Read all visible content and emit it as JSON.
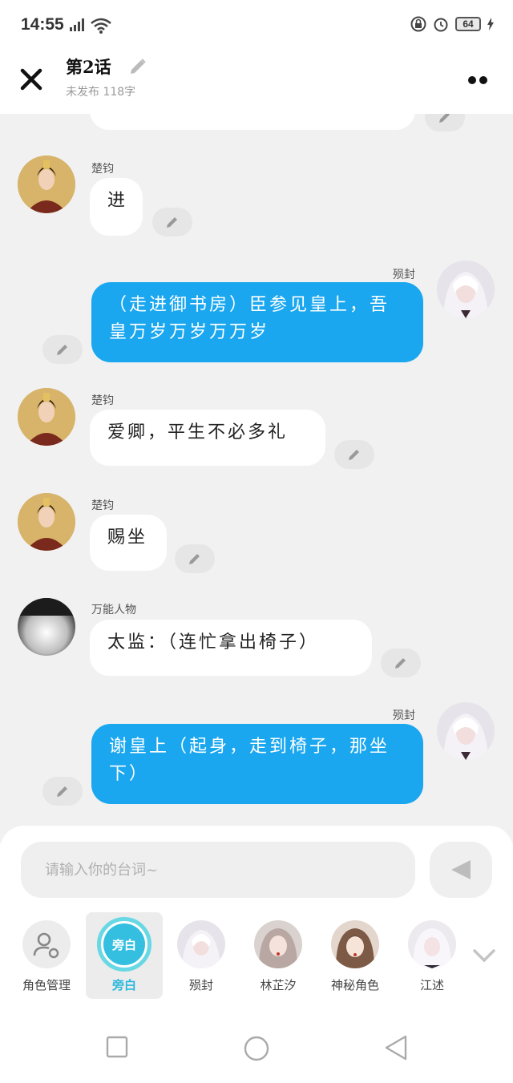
{
  "status": {
    "time": "14:55",
    "battery": "64"
  },
  "header": {
    "title": "第2话",
    "subtitle": "未发布 118字"
  },
  "messages": [
    {
      "sender": "楚钧",
      "text": "进",
      "side": "left",
      "avatar": "emperor"
    },
    {
      "sender": "殒封",
      "text": "（走进御书房）臣参见皇上，吾皇万岁万岁万万岁",
      "side": "right",
      "avatar": "silverhair"
    },
    {
      "sender": "楚钧",
      "text": "爱卿，平生不必多礼",
      "side": "left",
      "avatar": "emperor"
    },
    {
      "sender": "楚钧",
      "text": "赐坐",
      "side": "left",
      "avatar": "emperor"
    },
    {
      "sender": "万能人物",
      "text": "太监：（连忙拿出椅子）",
      "side": "left",
      "avatar": "universal"
    },
    {
      "sender": "殒封",
      "text": "谢皇上（起身，走到椅子，那坐下）",
      "side": "right",
      "avatar": "silverhair"
    }
  ],
  "composer": {
    "placeholder": "请输入你的台词~"
  },
  "roles": [
    {
      "label": "角色管理",
      "icon": "person-settings-icon"
    },
    {
      "label": "旁白",
      "badge": "旁白",
      "active": true
    },
    {
      "label": "殒封"
    },
    {
      "label": "林芷汐"
    },
    {
      "label": "神秘角色"
    },
    {
      "label": "江述"
    }
  ],
  "colors": {
    "accent_blue": "#1aa7ef",
    "narration_cyan": "#34bfe0",
    "chat_bg": "#f1f1f1"
  }
}
